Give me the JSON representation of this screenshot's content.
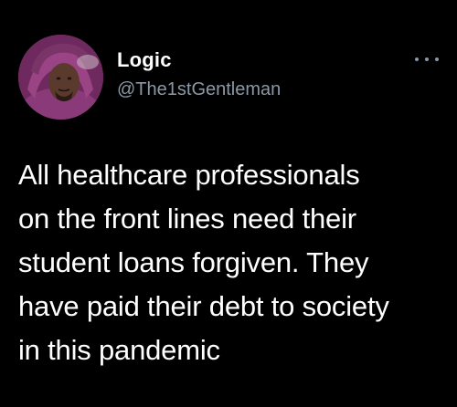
{
  "tweet": {
    "author": {
      "display_name": "Logic",
      "handle": "@The1stGentleman",
      "avatar_icon": "user-avatar"
    },
    "menu_icon": "more-options-icon",
    "text_lines": [
      "All healthcare professionals",
      "on the front lines need their",
      "student loans forgiven. They",
      "have paid their debt to society",
      "in this pandemic"
    ]
  },
  "colors": {
    "background": "#000000",
    "primary_text": "#ffffff",
    "secondary_text": "#8b98a5"
  }
}
